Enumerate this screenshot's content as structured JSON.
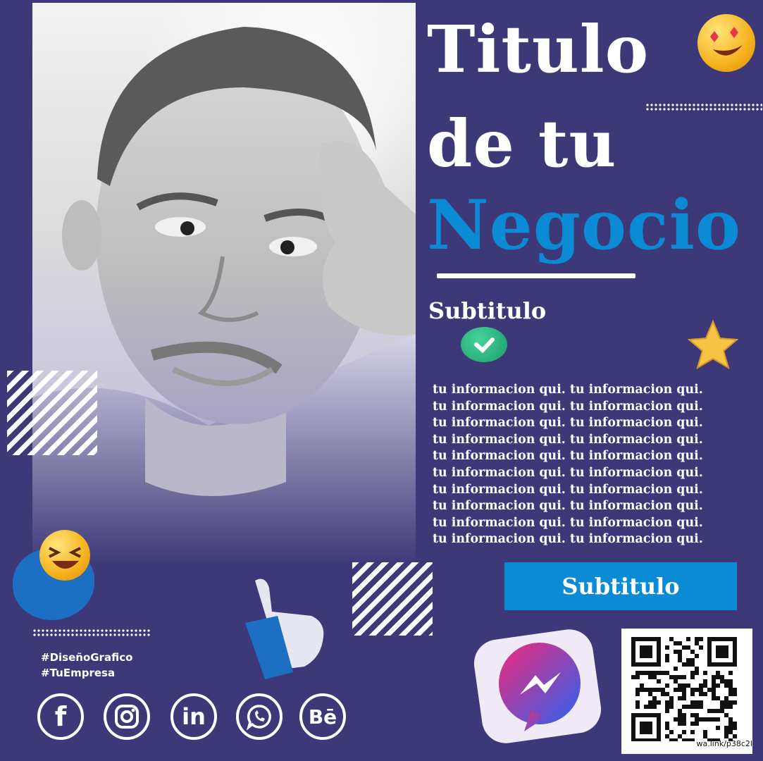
{
  "title": {
    "line1": "Titulo",
    "line2": "de tu",
    "line3": "Negocio"
  },
  "subtitle": "Subtitulo",
  "info_lines": [
    "tu informacion qui. tu informacion qui.",
    "tu informacion qui.  tu informacion qui.",
    "tu informacion qui. tu informacion qui.",
    "tu informacion qui.  tu informacion qui.",
    "tu informacion qui. tu informacion qui.",
    "tu informacion qui.  tu informacion qui.",
    "tu informacion qui. tu informacion qui.",
    "tu informacion qui.  tu informacion qui.",
    "tu informacion qui. tu informacion qui.",
    "tu informacion qui.  tu informacion qui."
  ],
  "cta_label": "Subtitulo",
  "hashtags": [
    "#DiseñoGrafico",
    "#TuEmpresa"
  ],
  "social": {
    "facebook": "f",
    "linkedin": "in",
    "behance": "Bē"
  },
  "qr_caption": "wa.link/p38c2l",
  "colors": {
    "background": "#3d3878",
    "accent_blue": "#0b8bd6",
    "text": "#ffffff"
  },
  "icons": [
    "love-eyes-emoji-icon",
    "laughing-emoji-icon",
    "check-icon",
    "star-icon",
    "thumbs-up-icon",
    "messenger-icon",
    "facebook-icon",
    "instagram-icon",
    "linkedin-icon",
    "whatsapp-icon",
    "behance-icon",
    "qr-code"
  ]
}
